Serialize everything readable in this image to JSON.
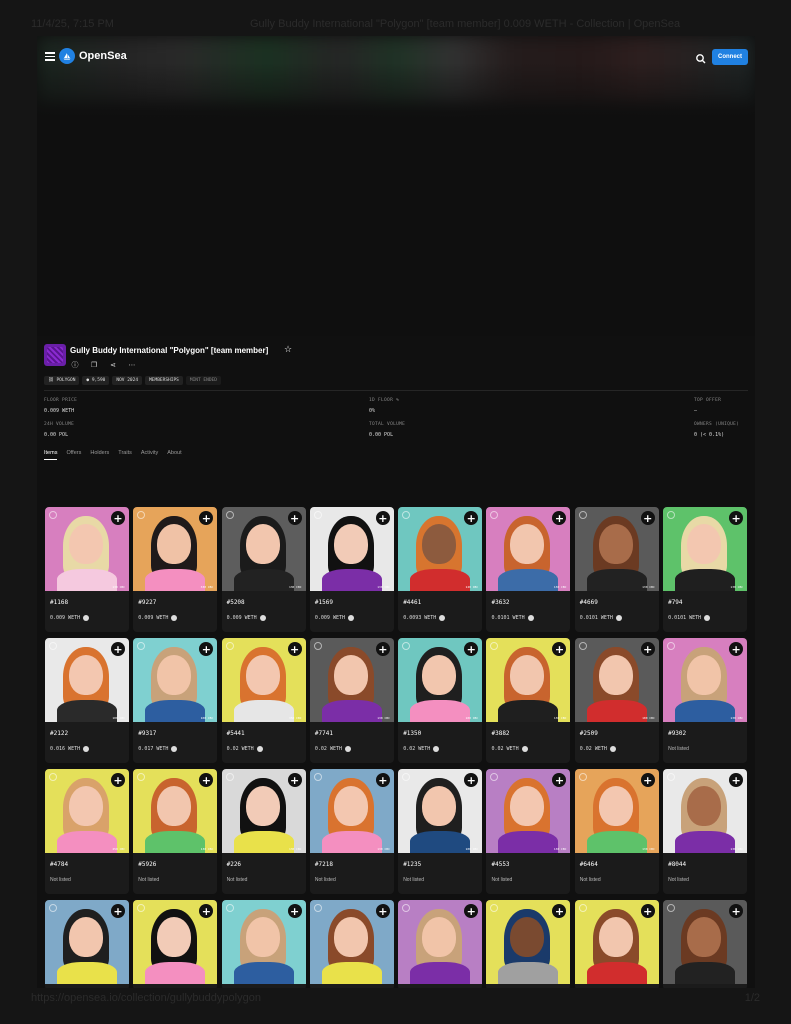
{
  "print": {
    "date": "11/4/25, 7:15 PM",
    "title": "Gully Buddy International \"Polygon\" [team member] 0.009 WETH - Collection | OpenSea",
    "url": "https://opensea.io/collection/gullybuddypolygon",
    "page": "1/2"
  },
  "topbar": {
    "logo": "OpenSea",
    "connect": "Connect"
  },
  "collection": {
    "title": "Gully Buddy International \"Polygon\" [team member]",
    "chips": [
      "POLYGON",
      "9,590",
      "NOV 2024",
      "MEMBERSHIPS",
      "MINT ENDED"
    ]
  },
  "stats": {
    "floor_price_label": "FLOOR PRICE",
    "floor_price": "0.009 WETH",
    "floor_1d_label": "1D FLOOR %",
    "floor_1d": "0%",
    "top_offer_label": "TOP OFFER",
    "top_offer": "—",
    "vol_24h_label": "24H VOLUME",
    "vol_24h": "0.00 POL",
    "total_vol_label": "TOTAL VOLUME",
    "total_vol": "0.00 POL",
    "owners_label": "OWNERS (UNIQUE)",
    "owners": "0 (< 0.1%)"
  },
  "tabs": [
    "Items",
    "Offers",
    "Holders",
    "Traits",
    "Activity",
    "About"
  ],
  "items": [
    {
      "id": "#1168",
      "price": "0.009 WETH",
      "bg": "#d77fbf",
      "hair": "#e8d9a6",
      "skin": "#f3c7b0",
      "cloth": "#f5c9df",
      "tag": "130 CBC"
    },
    {
      "id": "#9227",
      "price": "0.009 WETH",
      "bg": "#e6a45a",
      "hair": "#1f1a1a",
      "skin": "#f0c2a6",
      "cloth": "#f48fc0",
      "tag": "330 CBC"
    },
    {
      "id": "#5208",
      "price": "0.009 WETH",
      "bg": "#5d5d5d",
      "hair": "#1b1b1b",
      "skin": "#f2c6ae",
      "cloth": "#222222",
      "tag": "130 CBC"
    },
    {
      "id": "#1569",
      "price": "0.009 WETH",
      "bg": "#e8e8e8",
      "hair": "#111111",
      "skin": "#f2cbb7",
      "cloth": "#7b2ea7",
      "tag": "130 CBC"
    },
    {
      "id": "#4461",
      "price": "0.0093 WETH",
      "bg": "#6fc7c0",
      "hair": "#d7752f",
      "skin": "#8d5b3e",
      "cloth": "#d12d2d",
      "tag": "120 CBC"
    },
    {
      "id": "#3632",
      "price": "0.0101 WETH",
      "bg": "#d77fbf",
      "hair": "#c8642e",
      "skin": "#f2c6ae",
      "cloth": "#3c6ca8",
      "tag": "130 CBC"
    },
    {
      "id": "#4669",
      "price": "0.0101 WETH",
      "bg": "#5a5a5a",
      "hair": "#6b3a22",
      "skin": "#a86c4a",
      "cloth": "#222222",
      "tag": "130 CBC"
    },
    {
      "id": "#794",
      "price": "0.0101 WETH",
      "bg": "#5ec26a",
      "hair": "#e8d9a6",
      "skin": "#f3c7b0",
      "cloth": "#1f1f1f",
      "tag": "130 CBC"
    },
    {
      "id": "#2122",
      "price": "0.016 WETH",
      "bg": "#e9e9e9",
      "hair": "#d9732f",
      "skin": "#f3c7b0",
      "cloth": "#2a2a2a",
      "tag": "100 CBC"
    },
    {
      "id": "#9317",
      "price": "0.017 WETH",
      "bg": "#7fd0d0",
      "hair": "#c8a27a",
      "skin": "#f1c4a8",
      "cloth": "#2d5ea0",
      "tag": "100 CBC"
    },
    {
      "id": "#5441",
      "price": "0.02 WETH",
      "bg": "#e4e05a",
      "hair": "#d9732f",
      "skin": "#f3c7b0",
      "cloth": "#e6e6e6",
      "tag": "350 CBC"
    },
    {
      "id": "#7741",
      "price": "0.02 WETH",
      "bg": "#5a5a5a",
      "hair": "#8a4a2a",
      "skin": "#f2c6ae",
      "cloth": "#7b2ea7",
      "tag": "130 CBC"
    },
    {
      "id": "#1350",
      "price": "0.02 WETH",
      "bg": "#6fc7c0",
      "hair": "#1f1f1f",
      "skin": "#f2c6ae",
      "cloth": "#f48fc0",
      "tag": "100 CBC"
    },
    {
      "id": "#3882",
      "price": "0.02 WETH",
      "bg": "#e4e05a",
      "hair": "#c8642e",
      "skin": "#f2c6ae",
      "cloth": "#1f1f1f",
      "tag": "130 CBC"
    },
    {
      "id": "#2509",
      "price": "0.02 WETH",
      "bg": "#5a5a5a",
      "hair": "#8a4a2a",
      "skin": "#f2c6ae",
      "cloth": "#d12d2d",
      "tag": "100 CBC"
    },
    {
      "id": "#9302",
      "price": "Not listed",
      "bg": "#d77fbf",
      "hair": "#c8a27a",
      "skin": "#f1c4a8",
      "cloth": "#2d5ea0",
      "tag": "130 CBC"
    },
    {
      "id": "#4784",
      "price": "Not listed",
      "bg": "#e4e05a",
      "hair": "#d9a26a",
      "skin": "#f3c7b0",
      "cloth": "#f48fc0",
      "tag": "250 CBC"
    },
    {
      "id": "#5926",
      "price": "Not listed",
      "bg": "#e4e05a",
      "hair": "#c8642e",
      "skin": "#f2c6ae",
      "cloth": "#5ec26a",
      "tag": "130 CBC"
    },
    {
      "id": "#226",
      "price": "Not listed",
      "bg": "#d9d9d9",
      "hair": "#111111",
      "skin": "#f2cbb7",
      "cloth": "#e9e14a",
      "tag": "130 CBC"
    },
    {
      "id": "#7218",
      "price": "Not listed",
      "bg": "#7fa9c8",
      "hair": "#d9732f",
      "skin": "#f3c7b0",
      "cloth": "#f48fc0",
      "tag": "130 CBC"
    },
    {
      "id": "#1235",
      "price": "Not listed",
      "bg": "#e9e9e9",
      "hair": "#1f1f1f",
      "skin": "#f2c6ae",
      "cloth": "#1f4a80",
      "tag": "100 CBC"
    },
    {
      "id": "#4553",
      "price": "Not listed",
      "bg": "#b87fc4",
      "hair": "#d9732f",
      "skin": "#f3c7b0",
      "cloth": "#7b2ea7",
      "tag": "130 CBC"
    },
    {
      "id": "#6464",
      "price": "Not listed",
      "bg": "#e6a45a",
      "hair": "#d9732f",
      "skin": "#f3c7b0",
      "cloth": "#5ec26a",
      "tag": "130 CBC"
    },
    {
      "id": "#8044",
      "price": "Not listed",
      "bg": "#e9e9e9",
      "hair": "#c8a27a",
      "skin": "#a86c4a",
      "cloth": "#7b2ea7",
      "tag": "130 CBC"
    },
    {
      "id": "",
      "price": "",
      "bg": "#7fa9c8",
      "hair": "#1f1f1f",
      "skin": "#f2c6ae",
      "cloth": "#e9e14a",
      "tag": ""
    },
    {
      "id": "",
      "price": "",
      "bg": "#e4e05a",
      "hair": "#111111",
      "skin": "#f2cbb7",
      "cloth": "#f48fc0",
      "tag": ""
    },
    {
      "id": "",
      "price": "",
      "bg": "#7fd0d0",
      "hair": "#c8a27a",
      "skin": "#f1c4a8",
      "cloth": "#2d5ea0",
      "tag": ""
    },
    {
      "id": "",
      "price": "",
      "bg": "#7fa9c8",
      "hair": "#8a4a2a",
      "skin": "#f2c6ae",
      "cloth": "#e9e14a",
      "tag": ""
    },
    {
      "id": "",
      "price": "",
      "bg": "#b87fc4",
      "hair": "#c8a27a",
      "skin": "#f1c4a8",
      "cloth": "#7b2ea7",
      "tag": ""
    },
    {
      "id": "",
      "price": "",
      "bg": "#e4e05a",
      "hair": "#1a3a6a",
      "skin": "#7a4a30",
      "cloth": "#a0a0a0",
      "tag": ""
    },
    {
      "id": "",
      "price": "",
      "bg": "#e4e05a",
      "hair": "#8a4a2a",
      "skin": "#f2c6ae",
      "cloth": "#d12d2d",
      "tag": ""
    },
    {
      "id": "",
      "price": "",
      "bg": "#5a5a5a",
      "hair": "#6b3a22",
      "skin": "#a86c4a",
      "cloth": "#222222",
      "tag": ""
    }
  ]
}
